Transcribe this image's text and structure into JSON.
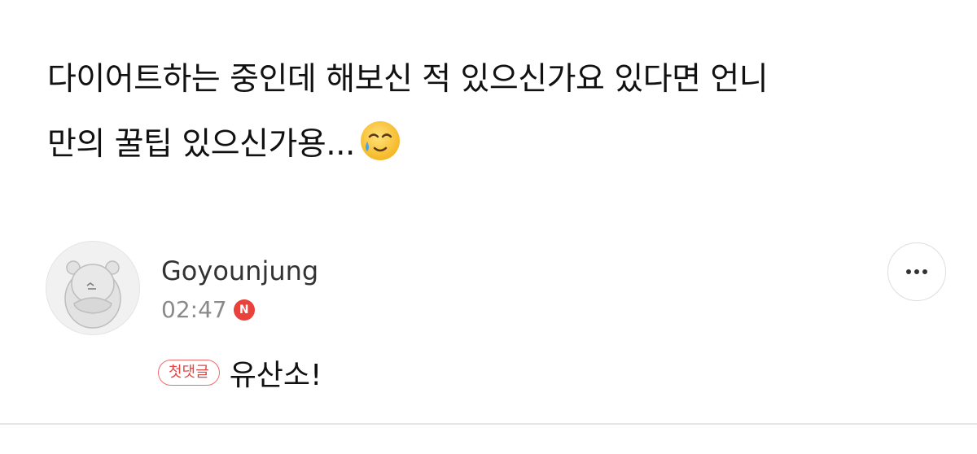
{
  "post": {
    "line1": "다이어트하는 중인데 해보신 적 있으신가요 있다면 언니",
    "line2": "만의 꿀팁 있으신가용...",
    "emoji": "face-holding-back-tears-icon"
  },
  "comment": {
    "author": "Goyounjung",
    "time": "02:47",
    "new_badge": "N",
    "first_comment_badge": "첫댓글",
    "text": "유산소!"
  },
  "colors": {
    "new_badge": "#e9423d",
    "first_comment_badge": "#e34545",
    "divider": "#e6e6e6"
  }
}
